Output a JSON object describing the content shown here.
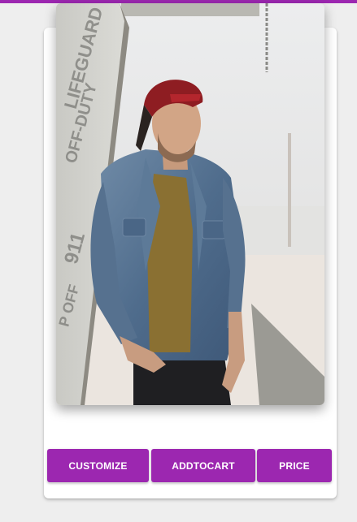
{
  "header": {
    "accent_color": "#9c27b0"
  },
  "product": {
    "image_icon": "man-in-denim-jacket-photo"
  },
  "actions": {
    "customize_label": "CUSTOMIZE",
    "add_to_cart_label": "ADDTOCART",
    "price_label": "PRICE"
  }
}
